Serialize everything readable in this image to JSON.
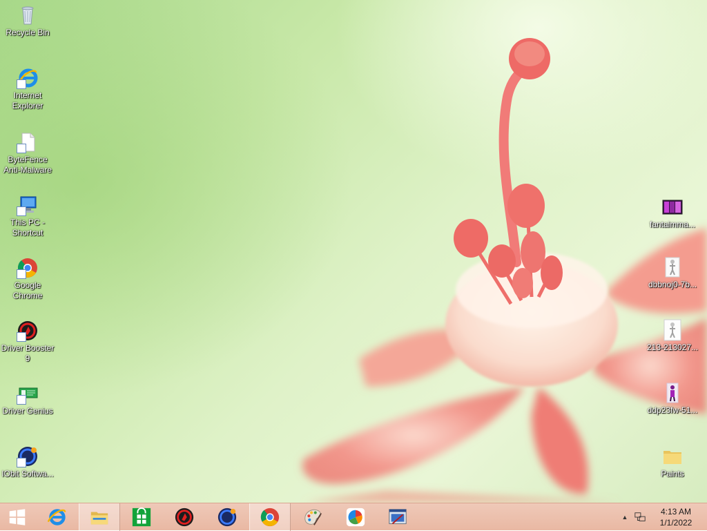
{
  "desktop_left": [
    {
      "id": "recycle-bin",
      "label": "Recycle Bin"
    },
    {
      "id": "internet-explorer",
      "label": "Internet Explorer"
    },
    {
      "id": "bytefence",
      "label": "ByteFence Anti-Malware"
    },
    {
      "id": "this-pc",
      "label": "This PC - Shortcut"
    },
    {
      "id": "google-chrome",
      "label": "Google Chrome"
    },
    {
      "id": "driver-booster",
      "label": "Driver Booster 9"
    },
    {
      "id": "driver-genius",
      "label": "Driver Genius"
    },
    {
      "id": "iobit",
      "label": "IObit Softwa..."
    }
  ],
  "desktop_right": [
    {
      "id": "fantaimma",
      "label": "fantaimma..."
    },
    {
      "id": "dbbnoj",
      "label": "dbbnoj0-7b..."
    },
    {
      "id": "img213",
      "label": "213-213027..."
    },
    {
      "id": "ddp23fw",
      "label": "ddp23fw-51..."
    },
    {
      "id": "paints",
      "label": "Paints"
    }
  ],
  "taskbar": {
    "start_icon": "windows-logo-icon",
    "pinned": [
      {
        "id": "ie",
        "icon": "internet-explorer-icon",
        "active": false
      },
      {
        "id": "file-explorer",
        "icon": "file-explorer-icon",
        "active": true
      },
      {
        "id": "store",
        "icon": "windows-store-icon",
        "active": false
      },
      {
        "id": "driver-booster",
        "icon": "driver-booster-icon",
        "active": false
      },
      {
        "id": "iobit",
        "icon": "iobit-icon",
        "active": false
      },
      {
        "id": "chrome",
        "icon": "chrome-icon",
        "active": true
      },
      {
        "id": "paint",
        "icon": "paint-palette-icon",
        "active": false
      },
      {
        "id": "color-app",
        "icon": "color-wheel-icon",
        "active": false
      },
      {
        "id": "remote-app",
        "icon": "window-app-icon",
        "active": false
      }
    ]
  },
  "clock": {
    "time": "4:13 AM",
    "date": "1/1/2022"
  },
  "colors": {
    "taskbar": "#ebbfac",
    "flower": "#f07a78"
  }
}
